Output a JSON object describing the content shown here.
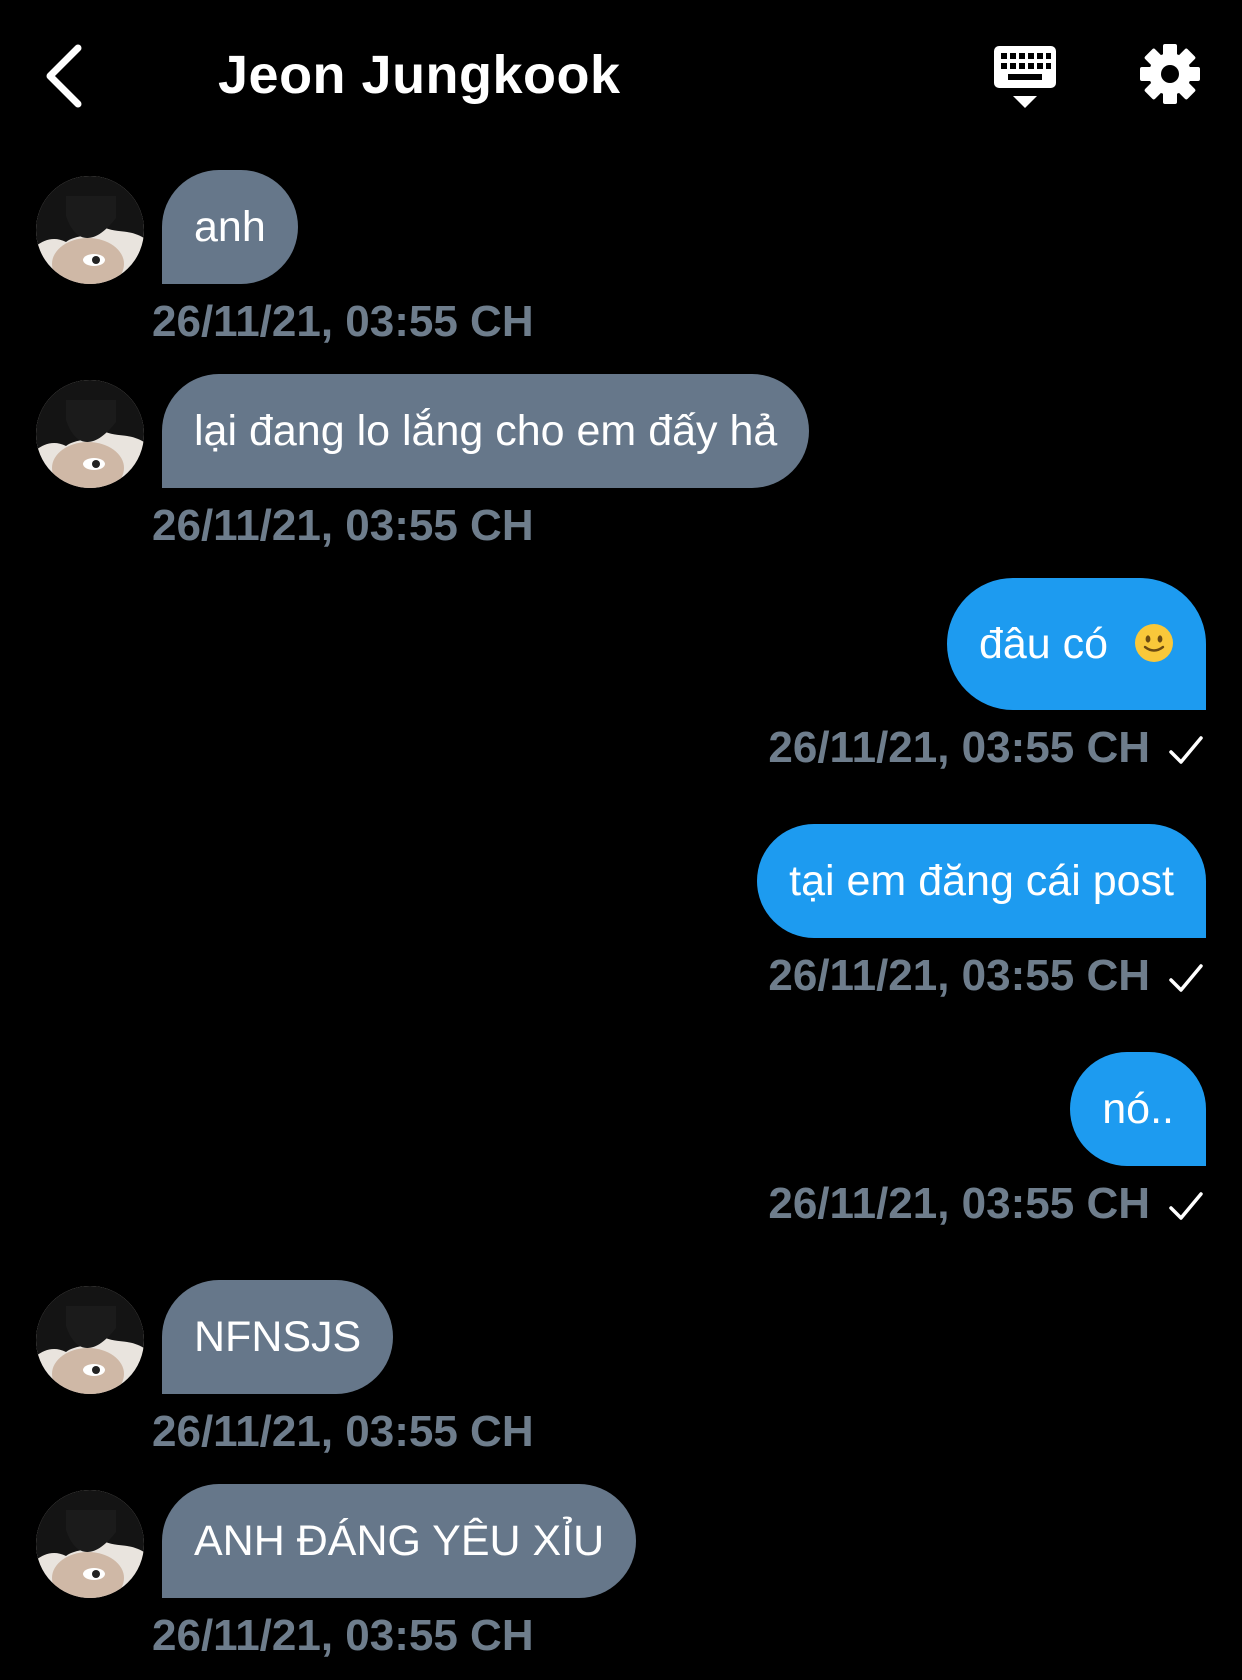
{
  "header": {
    "title": "Jeon Jungkook"
  },
  "colors": {
    "background": "#000000",
    "incoming_bubble": "#66778a",
    "outgoing_bubble": "#1d9bf0",
    "timestamp": "#6e7d8c"
  },
  "icons": {
    "back": "chevron-left-icon",
    "keyboard": "keyboard-icon",
    "settings": "gear-icon",
    "sent": "checkmark-icon",
    "emoji": "slightly-smiling-face-emoji"
  },
  "messages": [
    {
      "direction": "in",
      "text": "anh",
      "time": "26/11/21, 03:55 CH"
    },
    {
      "direction": "in",
      "text": "lại đang lo lắng cho em đấy hả",
      "time": "26/11/21, 03:55 CH"
    },
    {
      "direction": "out",
      "text": "đâu có",
      "emoji": "🙂",
      "time": "26/11/21, 03:55 CH",
      "sent": true
    },
    {
      "direction": "out",
      "text": "tại em đăng cái post",
      "time": "26/11/21, 03:55 CH",
      "sent": true
    },
    {
      "direction": "out",
      "text": "nó..",
      "time": "26/11/21, 03:55 CH",
      "sent": true
    },
    {
      "direction": "in",
      "text": "NFNSJS",
      "time": "26/11/21, 03:55 CH"
    },
    {
      "direction": "in",
      "text": "ANH ĐÁNG YÊU XỈU",
      "time": "26/11/21, 03:55 CH"
    }
  ]
}
